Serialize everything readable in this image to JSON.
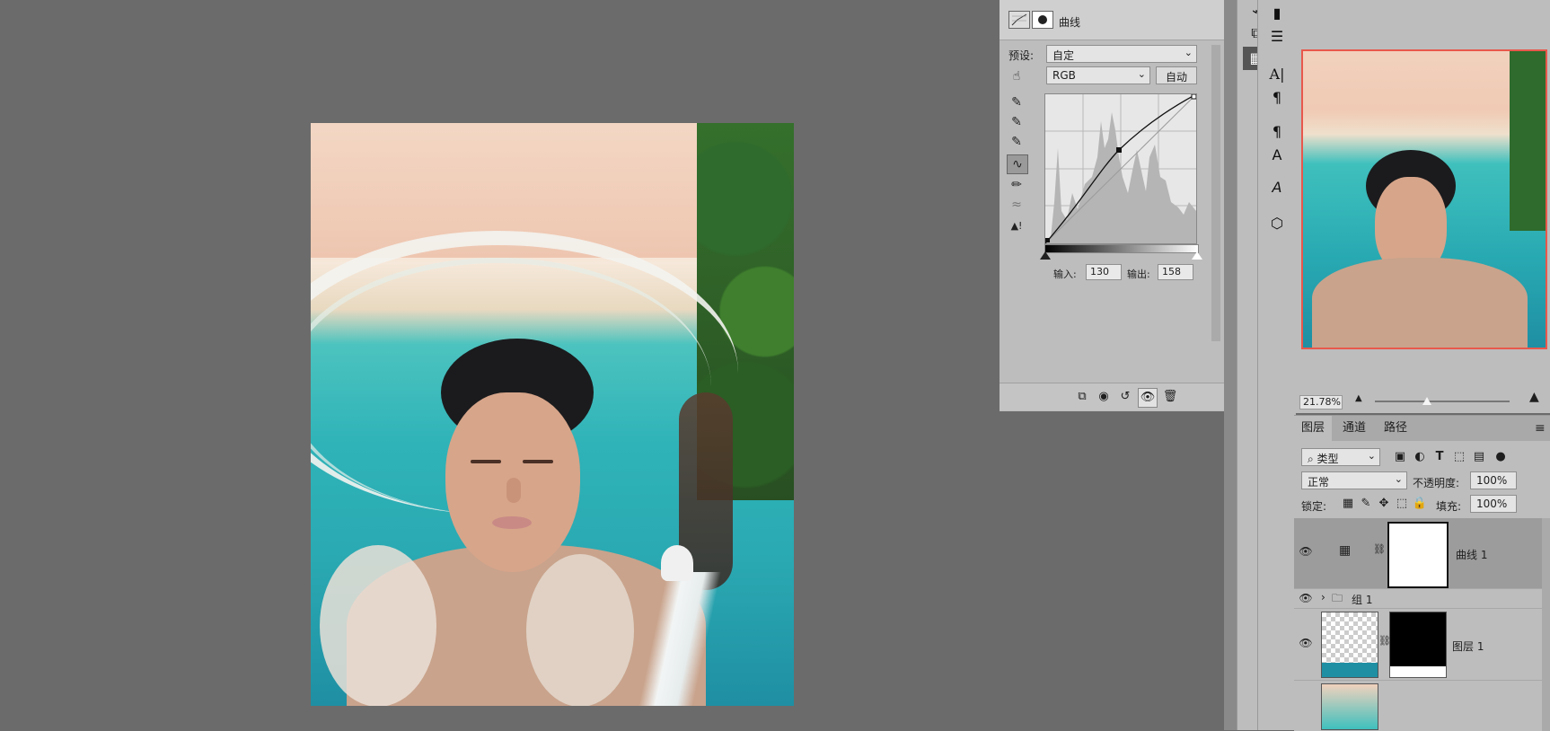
{
  "canvas": {
    "image_alt": "aerial beach photo composite with a man's face in the sea"
  },
  "properties": {
    "title": "曲线",
    "preset_label": "预设:",
    "preset_value": "自定",
    "channel_value": "RGB",
    "auto_label": "自动",
    "input_label": "输入:",
    "input_value": "130",
    "output_label": "输出:",
    "output_value": "158"
  },
  "navigator": {
    "zoom": "21.78%"
  },
  "layers": {
    "tabs": [
      "图层",
      "通道",
      "路径"
    ],
    "filter_label": "类型",
    "blend_mode": "正常",
    "opacity_label": "不透明度:",
    "opacity_value": "100%",
    "lock_label": "锁定:",
    "fill_label": "填充:",
    "fill_value": "100%",
    "items": [
      {
        "name": "曲线 1"
      },
      {
        "name": "组 1"
      },
      {
        "name": "图层 1"
      }
    ]
  },
  "colors": {
    "accent_nav_frame": "#e8584c",
    "panel_bg": "#bdbdbd",
    "canvas_bg": "#6b6b6b"
  }
}
